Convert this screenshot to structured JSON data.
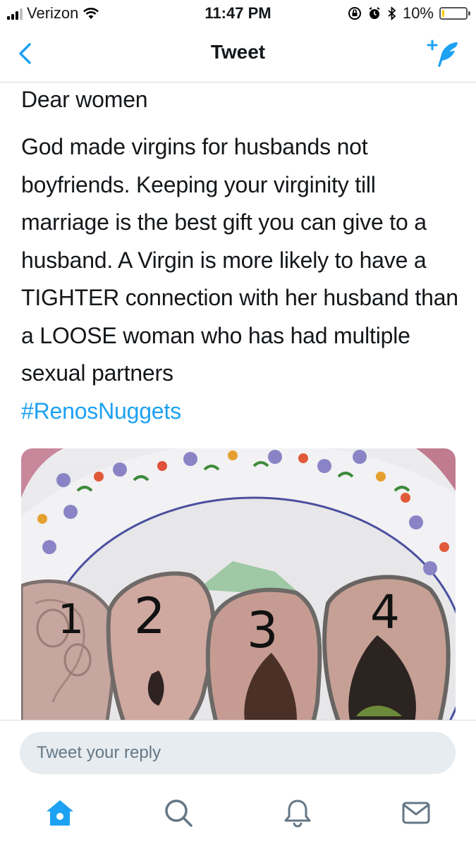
{
  "status_bar": {
    "carrier": "Verizon",
    "time": "11:47 PM",
    "battery_percent": "10%",
    "battery_level": 0.1,
    "icons": [
      "signal-icon",
      "wifi-icon",
      "orientation-lock-icon",
      "alarm-icon",
      "bluetooth-icon",
      "battery-icon"
    ]
  },
  "nav": {
    "title": "Tweet",
    "back_icon": "chevron-left-icon",
    "compose_icon": "compose-tweet-icon"
  },
  "tweet": {
    "lines": [
      "Dear women",
      "God made virgins for husbands not boyfriends. Keeping your virginity till marriage is the best gift you can give to a husband. A Virgin is more likely to have a TIGHTER connection with her husband than a LOOSE woman who has had multiple sexual partners"
    ],
    "hashtag": "#RenosNuggets",
    "image": {
      "labels": [
        "1",
        "2",
        "3",
        "4"
      ]
    }
  },
  "reply": {
    "placeholder": "Tweet your reply"
  },
  "tabs": [
    {
      "name": "home",
      "icon": "home-icon"
    },
    {
      "name": "search",
      "icon": "search-icon"
    },
    {
      "name": "notifications",
      "icon": "bell-icon"
    },
    {
      "name": "messages",
      "icon": "mail-icon"
    }
  ],
  "colors": {
    "accent": "#1da1f2",
    "tab_inactive": "#657786",
    "reply_bg": "#e6ecf0"
  }
}
